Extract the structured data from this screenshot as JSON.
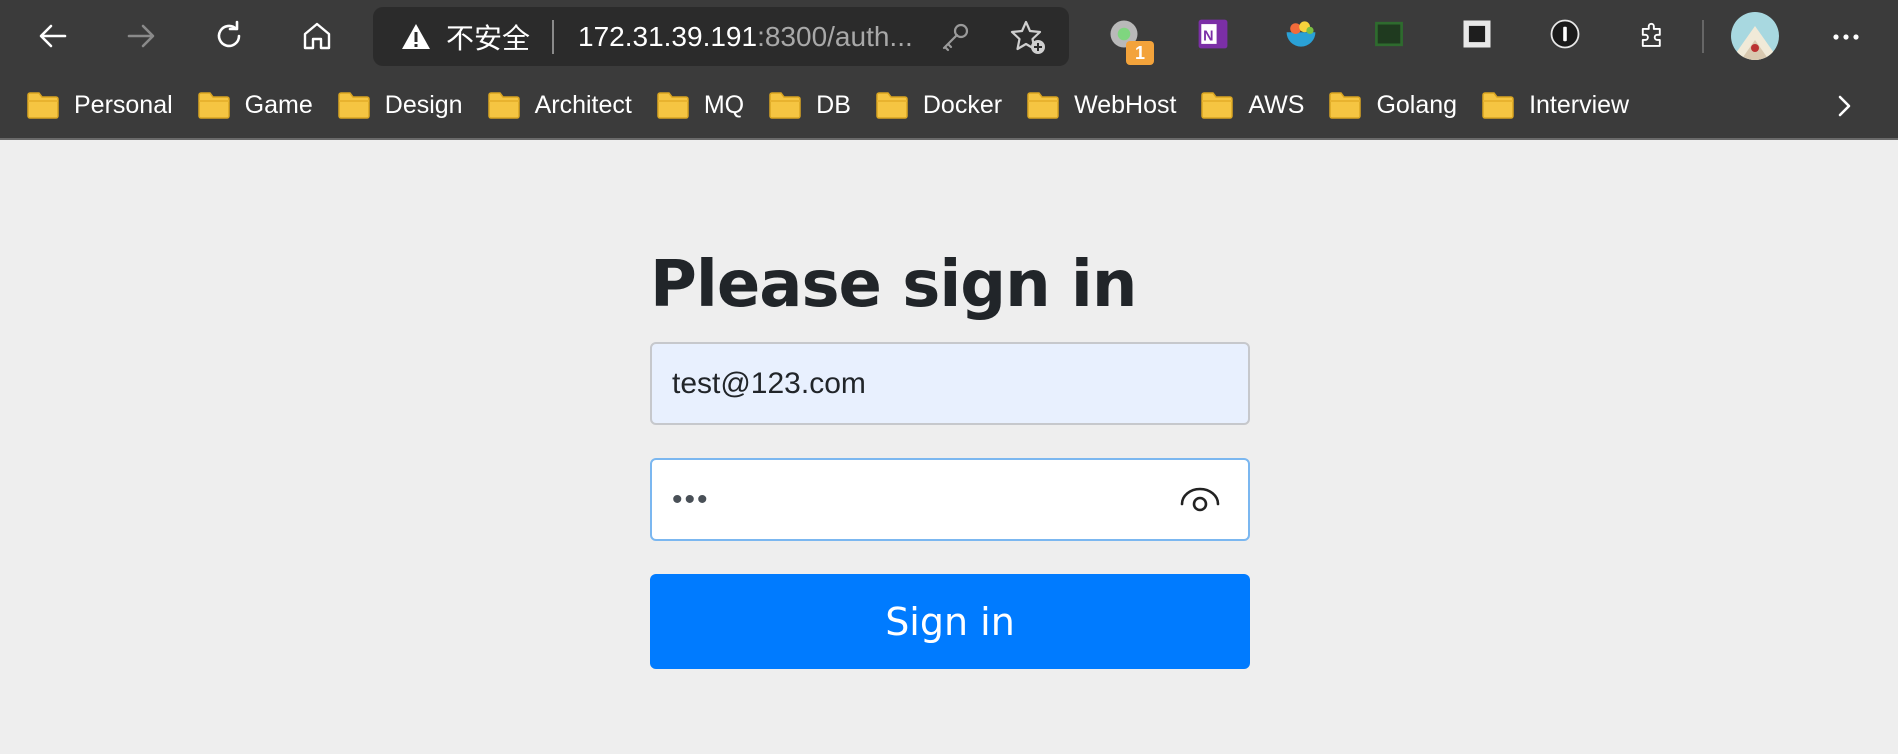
{
  "browser": {
    "security_label": "不安全",
    "url_host": "172.31.39.191",
    "url_rest": ":8300/auth...",
    "extension_badge_count": "1",
    "bookmarks": [
      "Personal",
      "Game",
      "Design",
      "Architect",
      "MQ",
      "DB",
      "Docker",
      "WebHost",
      "AWS",
      "Golang",
      "Interview"
    ]
  },
  "form": {
    "heading": "Please sign in",
    "email_value": "test@123.com",
    "password_mask": "•••",
    "submit_label": "Sign in"
  },
  "icons": {
    "back": "back-arrow-icon",
    "forward": "forward-arrow-icon",
    "refresh": "refresh-icon",
    "home": "home-icon",
    "warning": "warning-icon",
    "key": "key-icon",
    "favorite": "add-favorite-icon",
    "reveal": "eye-icon"
  },
  "colors": {
    "chrome_bg": "#3b3b3b",
    "page_bg": "#eeeeee",
    "primary_button": "#007bff",
    "autofill_bg": "#e8f0fe"
  }
}
